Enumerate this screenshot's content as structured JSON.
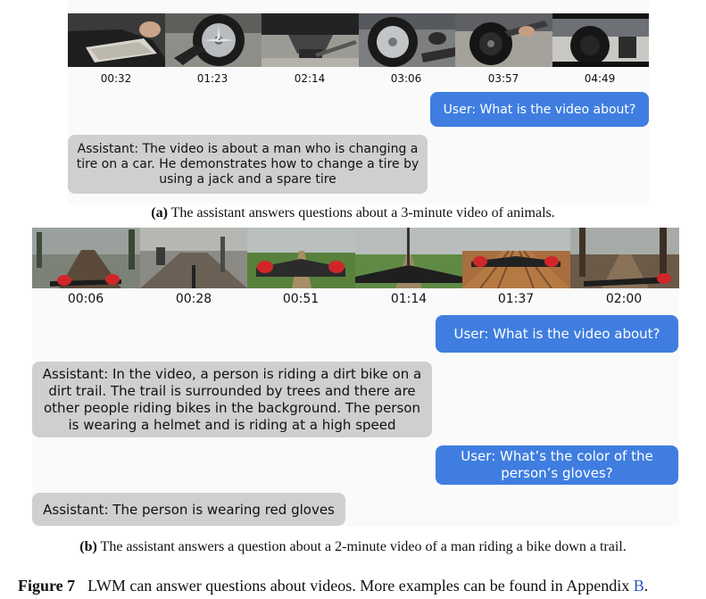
{
  "panel_a": {
    "timestamps": [
      "00:32",
      "01:23",
      "02:14",
      "03:06",
      "03:57",
      "04:49"
    ],
    "user_question": "User: What is the video about?",
    "assistant_answer": "Assistant: The video is about a man who is changing a tire on a car. He demonstrates how to change a tire by using a jack and a spare tire",
    "caption_label": "(a)",
    "caption_text": "The assistant answers questions about a 3-minute video of animals."
  },
  "panel_b": {
    "timestamps": [
      "00:06",
      "00:28",
      "00:51",
      "01:14",
      "01:37",
      "02:00"
    ],
    "user_question_1": "User: What is the video about?",
    "assistant_answer_1": "Assistant: In the video, a person is riding a dirt bike on a dirt trail. The trail is surrounded by trees and there are other people riding bikes in the background. The person is wearing a helmet and is riding at a high speed",
    "user_question_2": "User: What’s the color of the person’s gloves?",
    "assistant_answer_2": "Assistant: The person is wearing red gloves",
    "caption_label": "(b)",
    "caption_text": "The assistant answers a question about a 2-minute video of a man riding a bike down a trail."
  },
  "figure": {
    "label": "Figure 7",
    "caption_text": "LWM can answer questions about videos. More examples can be found in Appendix",
    "link_text": "B",
    "caption_end": "."
  },
  "colors": {
    "user_bubble": "#3f7ee0",
    "assistant_bubble": "#cfcfcf",
    "link": "#2a4fc4"
  }
}
